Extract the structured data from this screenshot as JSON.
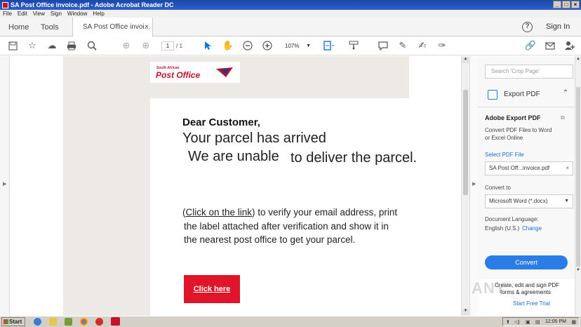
{
  "window": {
    "title": "SA Post Office invoice.pdf - Adobe Acrobat Reader DC",
    "buttons": [
      "_",
      "3",
      "x"
    ]
  },
  "menu": [
    "File",
    "Edit",
    "View",
    "Sign",
    "Window",
    "Help"
  ],
  "tabs": {
    "home": "Home",
    "tools": "Tools",
    "document": "SA Post Office invoi...",
    "close": "×"
  },
  "header_right": {
    "help": "?",
    "signin": "Sign In"
  },
  "toolbar": {
    "page_current": "1",
    "page_total": "/ 1",
    "zoom": "107%"
  },
  "document": {
    "logo_small": "South African",
    "logo_main": "Post Office",
    "greeting": "Dear Customer,",
    "line_arrived": "Your parcel has arrived",
    "line_unable": "We are unable",
    "line_deliver": "to deliver the parcel.",
    "para_open": "(",
    "para_link": "Click on the link",
    "para_rest1": ") to verify your email address, print",
    "para_line2": "the label attached after verification and show it in",
    "para_line3": "the nearest post office to get your parcel.",
    "button": "Click here",
    "accent_color": "#e0152a"
  },
  "right_panel": {
    "search_placeholder": "Search 'Crop Page'",
    "export_label": "Export PDF",
    "section_title": "Adobe Export PDF",
    "desc_line1": "Convert PDF Files to Word",
    "desc_line2": "or Excel Online",
    "select_file_label": "Select PDF File",
    "file_value": "SA Post Off...invoice.pdf",
    "convert_to_label": "Convert to",
    "convert_to_value": "Microsoft Word (*.docx)",
    "doc_lang_label": "Document Language:",
    "doc_lang_value": "English (U.S.)",
    "change_link": "Change",
    "convert_button": "Convert",
    "footer_line1": "Create, edit and sign PDF",
    "footer_line2": "forms & agreements",
    "footer_link": "Start Free Trial",
    "accent_color": "#2b7ce6"
  },
  "watermark": "ANY",
  "taskbar": {
    "start": "Start",
    "clock": "12:05 PM"
  }
}
